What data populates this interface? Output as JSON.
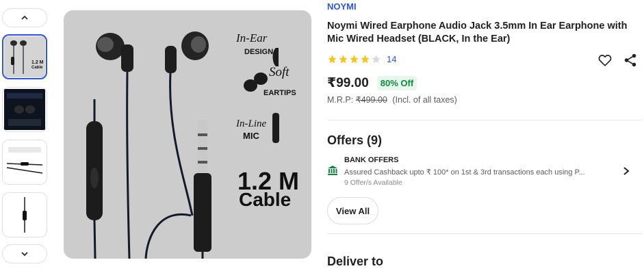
{
  "gallery": {
    "nav_up_icon": "chevron-up-icon",
    "nav_down_icon": "chevron-down-icon",
    "thumbnails": [
      {
        "label": "product main view",
        "active": true
      },
      {
        "label": "product with box",
        "active": false
      },
      {
        "label": "mic close-up",
        "active": false
      },
      {
        "label": "earphone full length",
        "active": false
      }
    ],
    "main_image": {
      "feature_in_ear": "In-Ear",
      "feature_design": "DESIGN",
      "feature_soft": "Soft",
      "feature_eartips": "EARTIPS",
      "feature_inline": "In-Line",
      "feature_mic": "MIC",
      "cable_length": "1.2 M",
      "cable_word": "Cable"
    }
  },
  "product": {
    "brand": "NOYMI",
    "title": "Noymi Wired Earphone Audio Jack 3.5mm In Ear Earphone with Mic Wired Headset (BLACK, In the Ear)",
    "rating": {
      "filled_stars": 4,
      "total_stars": 5,
      "count": "14"
    },
    "price": "₹99.00",
    "discount": "80% Off",
    "mrp_label": "M.R.P:",
    "mrp_value": "₹499.00",
    "tax_note": "(Incl. of all taxes)",
    "wishlist_icon": "heart-icon",
    "share_icon": "share-icon"
  },
  "offers": {
    "heading": "Offers (9)",
    "items": [
      {
        "type": "BANK OFFERS",
        "description": "Assured Cashback upto ₹ 100* on 1st & 3rd transactions each using P...",
        "count": "9 Offer/s Available",
        "icon": "bank-icon"
      }
    ],
    "view_all_label": "View All"
  },
  "delivery": {
    "heading": "Deliver to"
  },
  "colors": {
    "accent": "#2a55e5",
    "star": "#f5c518",
    "discount_text": "#0e8a3e",
    "discount_bg": "#e7f7ec",
    "bank_icon": "#0e8a3e"
  }
}
